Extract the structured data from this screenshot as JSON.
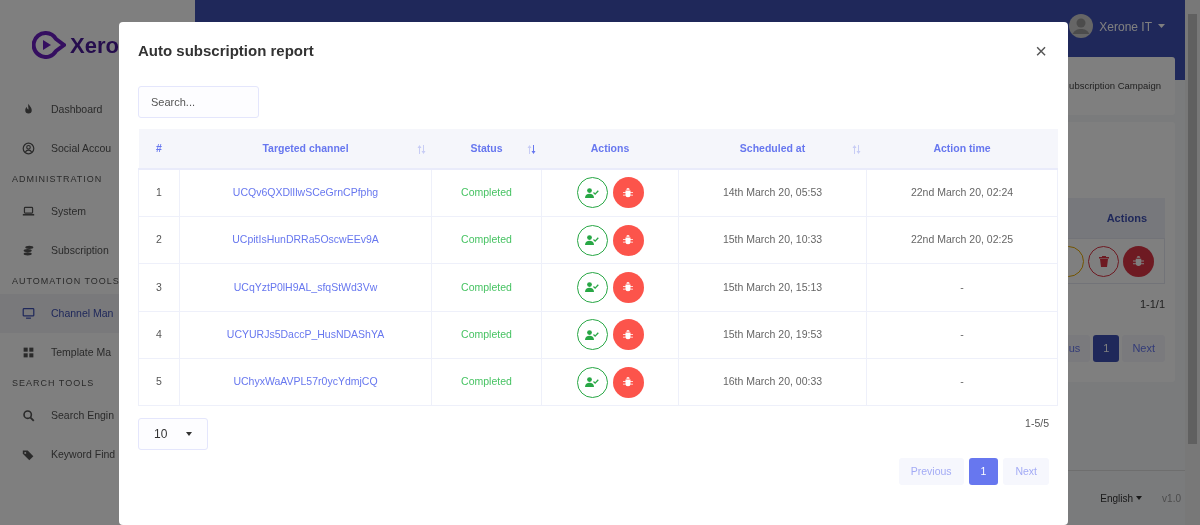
{
  "sidebar": {
    "logo": "Xero",
    "sections": [
      {
        "items": [
          {
            "label": "Dashboard",
            "selected": false
          },
          {
            "label": "Social Accou",
            "selected": false
          }
        ]
      },
      {
        "heading": "ADMINISTRATION",
        "items": [
          {
            "label": "System",
            "selected": false
          },
          {
            "label": "Subscription",
            "selected": false
          }
        ]
      },
      {
        "heading": "AUTOMATION TOOLS",
        "items": [
          {
            "label": "Channel Man",
            "selected": true
          },
          {
            "label": "Template Ma",
            "selected": false
          }
        ]
      },
      {
        "heading": "SEARCH TOOLS",
        "items": [
          {
            "label": "Search Engin",
            "selected": false
          },
          {
            "label": "Keyword Find",
            "selected": false
          }
        ]
      }
    ]
  },
  "header": {
    "user": "Xerone IT"
  },
  "background": {
    "card_title": "ubscription Campaign",
    "table_header": "Actions",
    "count": "1-1/1",
    "pagination": [
      {
        "label": "us",
        "selected": false
      },
      {
        "label": "1",
        "selected": true
      },
      {
        "label": "Next",
        "selected": false
      }
    ],
    "language": "English",
    "version": "v1.0"
  },
  "modal": {
    "title": "Auto subscription report",
    "close": "×",
    "search": {
      "placeholder": "Search..."
    },
    "table": {
      "columns": [
        {
          "label": "#"
        },
        {
          "label": "Targeted channel",
          "sorted": false
        },
        {
          "label": "Status",
          "sorted": true
        },
        {
          "label": "Actions"
        },
        {
          "label": "Scheduled at",
          "sorted": false
        },
        {
          "label": "Action time"
        }
      ],
      "rows": [
        {
          "index": "1",
          "channel": "UCQv6QXDlIlwSCeGrnCPfphg",
          "status": "Completed",
          "scheduled": "14th March 20, 05:53",
          "action_time": "22nd March 20, 02:24"
        },
        {
          "index": "2",
          "channel": "UCpitIsHunDRRa5OscwEEv9A",
          "status": "Completed",
          "scheduled": "15th March 20, 10:33",
          "action_time": "22nd March 20, 02:25"
        },
        {
          "index": "3",
          "channel": "UCqYztP0lH9AL_sfqStWd3Vw",
          "status": "Completed",
          "scheduled": "15th March 20, 15:13",
          "action_time": "-"
        },
        {
          "index": "4",
          "channel": "UCYURJs5DaccP_HusNDAShYA",
          "status": "Completed",
          "scheduled": "15th March 20, 19:53",
          "action_time": "-"
        },
        {
          "index": "5",
          "channel": "UChyxWaAVPL57r0ycYdmjCQ",
          "status": "Completed",
          "scheduled": "16th March 20, 00:33",
          "action_time": "-"
        }
      ]
    },
    "page_size": "10",
    "count": "1-5/5",
    "pagination": [
      {
        "label": "Previous",
        "selected": false
      },
      {
        "label": "1",
        "selected": true
      },
      {
        "label": "Next",
        "selected": false
      }
    ]
  }
}
